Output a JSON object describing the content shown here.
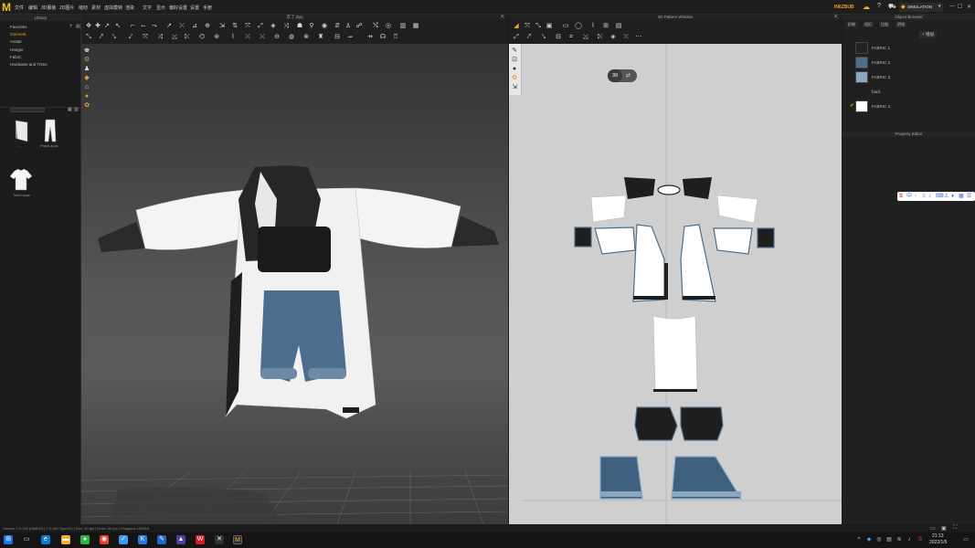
{
  "menu": {
    "items": [
      "文件",
      "编辑",
      "3D服装",
      "2D图片",
      "缝纫",
      "素材",
      "虚拟模特",
      "渲染",
      "文字",
      "显示",
      "偏好设置",
      "设置",
      "手册"
    ]
  },
  "header": {
    "user": "IN6ZBUB",
    "simulation_label": "SIMULATION"
  },
  "library": {
    "title": "Library",
    "items": [
      "Favorites",
      "Garment",
      "Avatar",
      "Hanger",
      "Fabric",
      "Hardware and Trims"
    ],
    "active_index": 1,
    "thumbs": [
      {
        "caption": "...",
        "icon": "garment-icon"
      },
      {
        "caption": "Pants.zpac",
        "icon": "pants-icon"
      },
      {
        "caption": "Tshirt.zpac",
        "icon": "tshirt-icon"
      }
    ]
  },
  "viewport3d": {
    "title": "衣了.Zprj"
  },
  "pattern2d": {
    "title": "2D Pattern Window",
    "zoom": "39"
  },
  "object_browser": {
    "title": "Object Browser",
    "tabs": [
      "织物",
      "纽扣",
      "拉链",
      "明线"
    ],
    "add_label": "+ 增加",
    "fabrics": [
      {
        "label": "FABRIC 1",
        "color": "#232323"
      },
      {
        "label": "FABRIC 2",
        "color": "#4f6e8c"
      },
      {
        "label": "FABRIC 3",
        "color": "#8aa7bf"
      },
      {
        "label": "hard",
        "color": "#1f1f1f"
      },
      {
        "label": "FABRIC 4",
        "color": "#ffffff"
      }
    ],
    "property_editor_title": "Property Editor"
  },
  "status": {
    "text": "Version 7.0.100 (r40846) | 7.0.100 OpenGL | Sim: 30 fps | Draw: 60 fps | Polygons 152018"
  },
  "taskbar": {
    "time": "21:13",
    "date": "2022/1/5"
  },
  "colors": {
    "accent": "#f0a020",
    "pattern_bg": "#cfcfcf",
    "fabric_blue": "#4f6e8c",
    "fabric_light_blue": "#8aa7bf"
  }
}
